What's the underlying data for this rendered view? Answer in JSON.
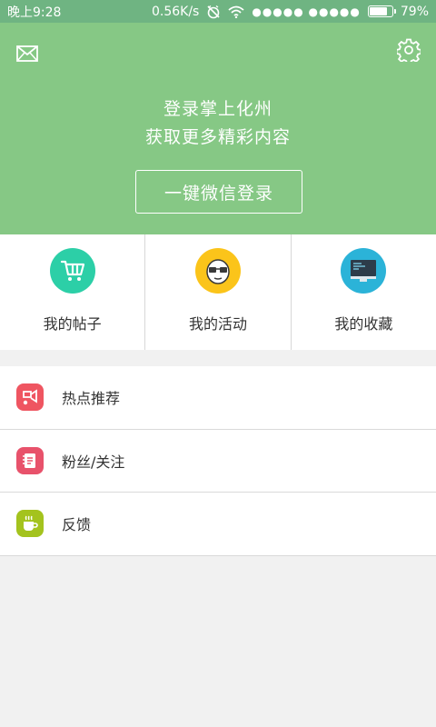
{
  "status_bar": {
    "time": "晚上9:28",
    "network_speed": "0.56K/s",
    "signal_dots": "●●●●● ●●●●●",
    "battery_percent": "79%",
    "battery_level": 0.79
  },
  "header": {
    "line1": "登录掌上化州",
    "line2": "获取更多精彩内容",
    "login_button": "一键微信登录",
    "icons": {
      "left": "mail-icon",
      "right": "gear-icon"
    },
    "bg_color": "#86c885"
  },
  "quick_grid": [
    {
      "label": "我的帖子",
      "icon": "shopping-cart-icon",
      "color": "#2ccfa7"
    },
    {
      "label": "我的活动",
      "icon": "face-glasses-icon",
      "color": "#fbc41a"
    },
    {
      "label": "我的收藏",
      "icon": "monitor-icon",
      "color": "#2bb3d8"
    }
  ],
  "menu": [
    {
      "label": "热点推荐",
      "icon": "hot-recommend-icon",
      "color": "#ef5561"
    },
    {
      "label": "粉丝/关注",
      "icon": "notebook-icon",
      "color": "#e8526b"
    },
    {
      "label": "反馈",
      "icon": "coffee-cup-icon",
      "color": "#a4c31e"
    }
  ]
}
